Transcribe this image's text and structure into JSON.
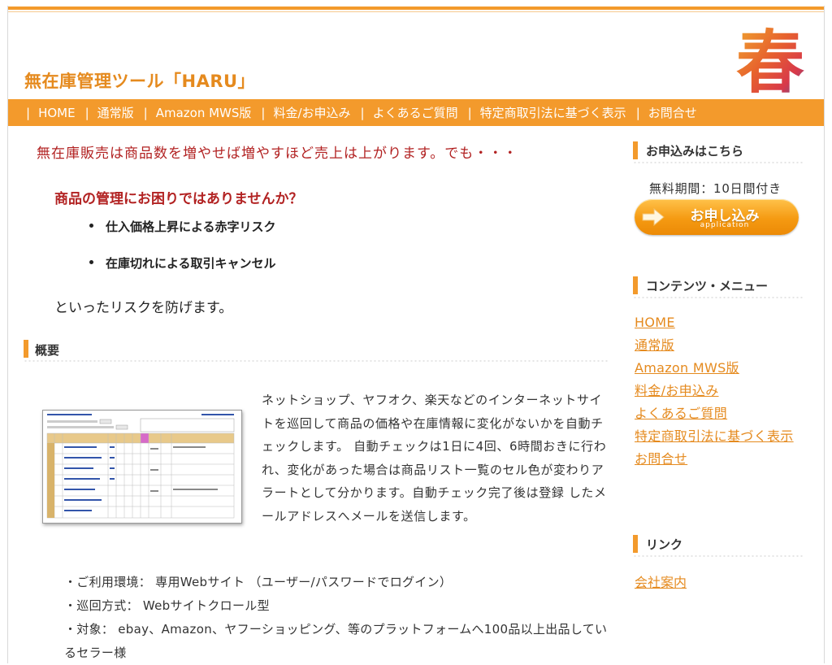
{
  "site": {
    "title": "無在庫管理ツール「HARU」",
    "logo_kanji": "春"
  },
  "nav": {
    "separator": "|",
    "items": [
      {
        "label": "HOME"
      },
      {
        "label": "通常版"
      },
      {
        "label": "Amazon MWS版"
      },
      {
        "label": "料金/お申込み"
      },
      {
        "label": "よくあるご質問"
      },
      {
        "label": "特定商取引法に基づく表示"
      },
      {
        "label": "お問合せ"
      }
    ]
  },
  "main": {
    "lead": "無在庫販売は商品数を増やせば増やすほど売上は上がります。でも・・・",
    "sub_heading": "商品の管理にお困りではありませんか？",
    "risks": [
      {
        "text": "仕入価格上昇による赤字リスク"
      },
      {
        "text": "在庫切れによる取引キャンセル"
      }
    ],
    "after_list": "といったリスクを防げます。",
    "overview": {
      "heading": "概要",
      "description": "ネットショップ、ヤフオク、楽天などのインターネットサイトを巡回して商品の価格や在庫情報に変化がないかを自動チェックします。 自動チェックは1日に4回、6時間おきに行われ、変化があった場合は商品リスト一覧のセル色が変わりアラートとして分かります。自動チェック完了後は登録 したメールアドレスへメールを送信します。",
      "specs": [
        {
          "text": "・ご利用環境： 専用Webサイト （ユーザー/パスワードでログイン）"
        },
        {
          "text": "・巡回方式： Webサイトクロール型"
        },
        {
          "text": "・対象： ebay、Amazon、ヤフーショッピング、等のプラットフォームへ100品以上出品しているセラー様"
        }
      ]
    }
  },
  "sidebar": {
    "apply": {
      "heading": "お申込みはこちら",
      "free_period": "無料期間：10日間付き",
      "button_label": "お申し込み",
      "button_sub": "application"
    },
    "contents_menu": {
      "heading": "コンテンツ・メニュー",
      "links": [
        {
          "label": "HOME"
        },
        {
          "label": "通常版"
        },
        {
          "label": "Amazon MWS版"
        },
        {
          "label": "料金/お申込み"
        },
        {
          "label": "よくあるご質問"
        },
        {
          "label": "特定商取引法に基づく表示"
        },
        {
          "label": "お問合せ"
        }
      ]
    },
    "links": {
      "heading": "リンク",
      "company": "会社案内"
    }
  },
  "colors": {
    "accent": "#f39a2c",
    "title": "#e58a1e",
    "lead_red": "#b22222",
    "link": "#e58a1e"
  }
}
